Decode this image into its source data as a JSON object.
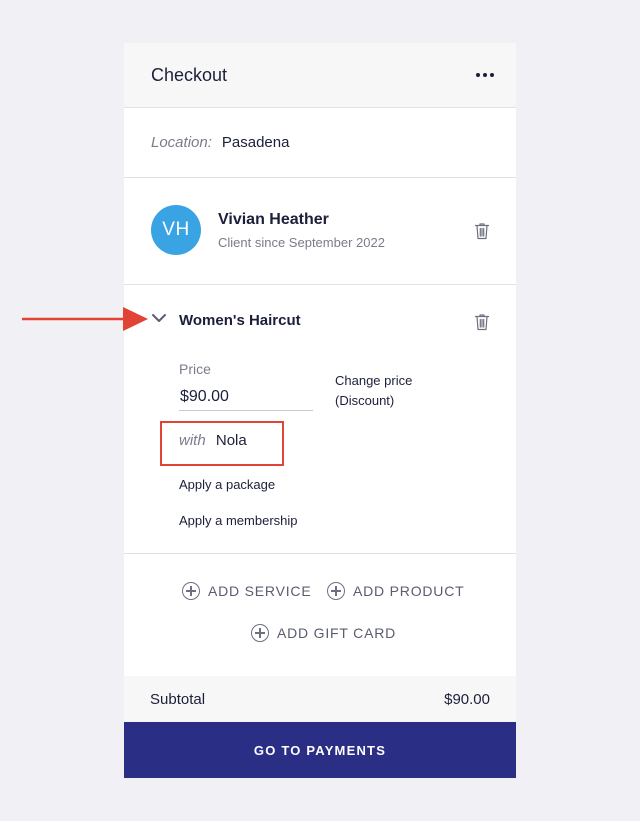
{
  "header": {
    "title": "Checkout",
    "more_icon": "more-horizontal-icon"
  },
  "location": {
    "label": "Location:",
    "value": "Pasadena"
  },
  "client": {
    "initials": "VH",
    "avatar_color": "#3aa3e3",
    "name": "Vivian Heather",
    "since": "Client since September 2022",
    "delete_icon": "trash-icon"
  },
  "service": {
    "expand_icon": "chevron-down-icon",
    "name": "Women's Haircut",
    "price_label": "Price",
    "price_value": "$90.00",
    "change_price_line1": "Change price",
    "change_price_line2": "(Discount)",
    "staff_prefix": "with",
    "staff_name": "Nola",
    "apply_package": "Apply a package",
    "apply_membership": "Apply a membership",
    "delete_icon": "trash-icon"
  },
  "actions": {
    "add_service": "ADD SERVICE",
    "add_product": "ADD PRODUCT",
    "add_gift_card": "ADD GIFT CARD",
    "icon": "plus-circle-icon"
  },
  "summary": {
    "subtotal_label": "Subtotal",
    "subtotal_value": "$90.00"
  },
  "footer": {
    "pay_label": "GO TO PAYMENTS",
    "pay_color": "#2b2e85"
  },
  "annotations": {
    "arrow_color": "#e14434",
    "box_color": "#e14434"
  }
}
